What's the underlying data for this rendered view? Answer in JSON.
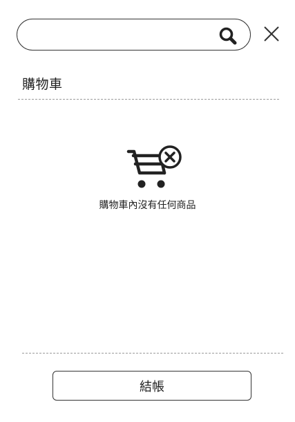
{
  "search": {
    "value": "",
    "placeholder": "",
    "icon": "search-icon"
  },
  "close": {
    "icon": "close-icon"
  },
  "cart": {
    "title": "購物車",
    "empty_icon": "empty-cart-icon",
    "empty_message": "購物車內沒有任何商品",
    "checkout_label": "結帳"
  },
  "colors": {
    "text": "#222222",
    "border": "#333333",
    "divider": "#9a9a9a",
    "icon": "#222222"
  }
}
